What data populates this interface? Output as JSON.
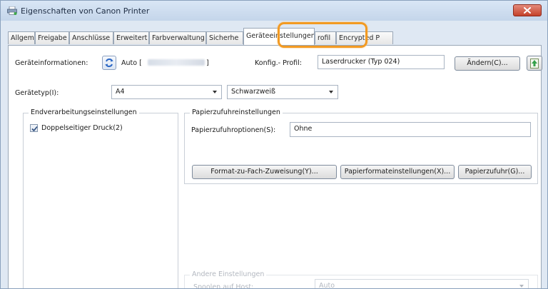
{
  "window": {
    "title": "Eigenschaften von Canon Printer"
  },
  "tabs": [
    {
      "label": "Allgemein"
    },
    {
      "label": "Freigabe"
    },
    {
      "label": "Anschlüsse"
    },
    {
      "label": "Erweitert"
    },
    {
      "label": "Farbverwaltung"
    },
    {
      "label": "Sicherhe"
    },
    {
      "label": "Geräteeinstellungen",
      "active": true
    },
    {
      "label": "rofil"
    },
    {
      "label": "Encrypted P"
    }
  ],
  "device_info": {
    "label": "Geräteinformationen:",
    "auto_prefix": "Auto [",
    "auto_suffix": "]"
  },
  "profile": {
    "label": "Konfig.- Profil:",
    "value": "Laserdrucker (Typ 024)",
    "change_button": "Ändern(C)..."
  },
  "device_type": {
    "label": "Gerätetyp(I):",
    "paper_select": "A4",
    "color_select": "Schwarzweiß"
  },
  "finishing": {
    "group_title": "Endverarbeitungseinstellungen",
    "duplex_label": "Doppelseitiger Druck(2)",
    "duplex_checked": true
  },
  "paper_feed": {
    "group_title": "Papierzufuhreinstellungen",
    "options_label": "Papierzufuhroptionen(S):",
    "options_value": "Ohne",
    "buttons": {
      "format_to_tray": "Format-zu-Fach-Zuweisung(Y)...",
      "paper_format": "Papierformateinstellungen(X)...",
      "paper_feed": "Papierzufuhr(G)..."
    }
  },
  "other": {
    "group_title": "Andere Einstellungen",
    "spool_label": "Spoolen auf Host:",
    "spool_value": "Auto"
  },
  "colors": {
    "highlight": "#f29a22",
    "close_button": "#c4422b"
  }
}
